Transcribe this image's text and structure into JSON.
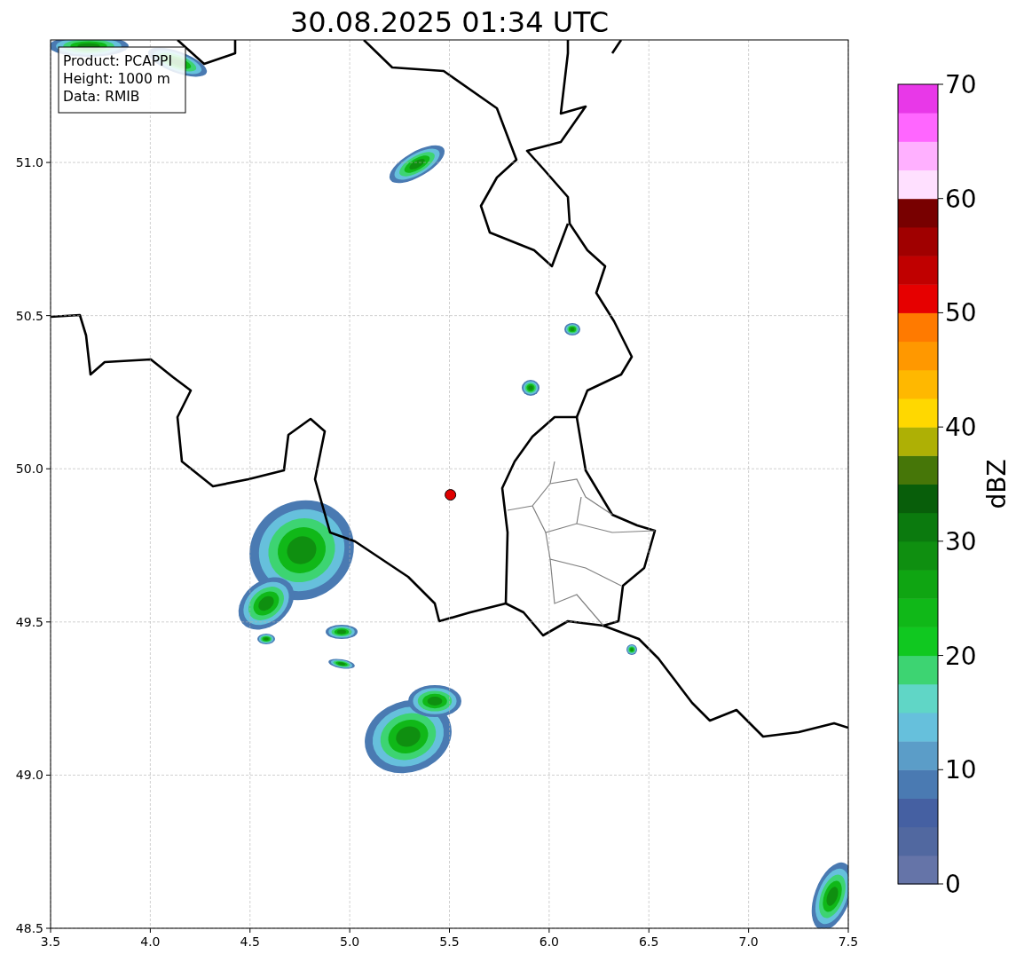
{
  "title": "30.08.2025 01:34 UTC",
  "info_box": {
    "lines": [
      "Product: PCAPPI",
      "Height: 1000 m",
      "Data: RMIB"
    ]
  },
  "map": {
    "chart_data": {
      "type": "scatter",
      "grid": true,
      "xlim": [
        3.5,
        7.5
      ],
      "ylim": [
        48.5,
        51.4
      ],
      "xticks": [
        {
          "value": 3.5,
          "label": "3.5"
        },
        {
          "value": 4.0,
          "label": "4.0"
        },
        {
          "value": 4.5,
          "label": "4.5"
        },
        {
          "value": 5.0,
          "label": "5.0"
        },
        {
          "value": 5.5,
          "label": "5.5"
        },
        {
          "value": 6.0,
          "label": "6.0"
        },
        {
          "value": 6.5,
          "label": "6.5"
        },
        {
          "value": 7.0,
          "label": "7.0"
        },
        {
          "value": 7.5,
          "label": "7.5"
        }
      ],
      "yticks": [
        {
          "value": 48.5,
          "label": "48.5"
        },
        {
          "value": 49.0,
          "label": "49.0"
        },
        {
          "value": 49.5,
          "label": "49.5"
        },
        {
          "value": 50.0,
          "label": "50.0"
        },
        {
          "value": 50.5,
          "label": "50.5"
        },
        {
          "value": 51.0,
          "label": "51.0"
        }
      ],
      "x": [
        5.505
      ],
      "series": [
        {
          "color": "#e00000",
          "values": [
            49.915
          ]
        }
      ]
    }
  },
  "colorbar": {
    "label": "dBZ",
    "ticks": [
      "70",
      "60",
      "50",
      "40",
      "30",
      "20",
      "10",
      "0"
    ],
    "bands": [
      {
        "color": "#6574a8"
      },
      {
        "color": "#5168a0"
      },
      {
        "color": "#4560a2"
      },
      {
        "color": "#4a7ab2"
      },
      {
        "color": "#5b9dc8"
      },
      {
        "color": "#66c0dc"
      },
      {
        "color": "#60d6c6"
      },
      {
        "color": "#3dd472"
      },
      {
        "color": "#10c820"
      },
      {
        "color": "#10b818"
      },
      {
        "color": "#0fa512"
      },
      {
        "color": "#0f8f10"
      },
      {
        "color": "#0b7a0e"
      },
      {
        "color": "#085e0a"
      },
      {
        "color": "#467608"
      },
      {
        "color": "#aeb005"
      },
      {
        "color": "#ffd800"
      },
      {
        "color": "#ffb800"
      },
      {
        "color": "#ff9800"
      },
      {
        "color": "#ff7a00"
      },
      {
        "color": "#e60000"
      },
      {
        "color": "#c00000"
      },
      {
        "color": "#a00000"
      },
      {
        "color": "#780000"
      },
      {
        "color": "#ffe0ff"
      },
      {
        "color": "#ffb0ff"
      },
      {
        "color": "#ff66ff"
      },
      {
        "color": "#e838e8"
      }
    ]
  }
}
